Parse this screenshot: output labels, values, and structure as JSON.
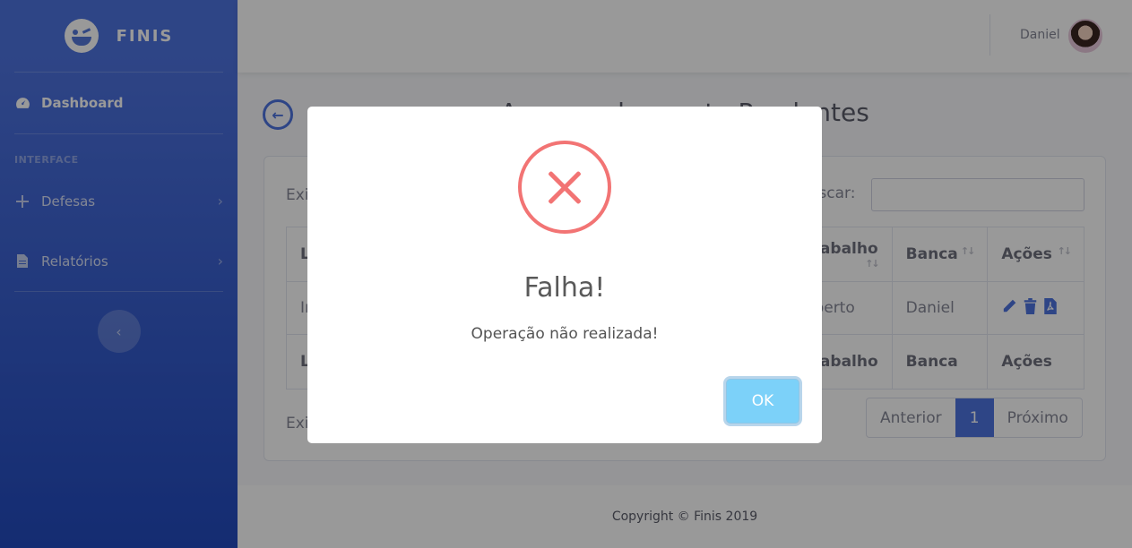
{
  "brand": {
    "name": "FINIS"
  },
  "sidebar": {
    "dashboard": "Dashboard",
    "heading": "INTERFACE",
    "items": [
      {
        "label": "Defesas",
        "icon": "plus-icon"
      },
      {
        "label": "Relatórios",
        "icon": "file-icon"
      }
    ]
  },
  "topbar": {
    "user_name": "Daniel"
  },
  "main": {
    "title": "Acompanhamento Pendentes",
    "length_label": "Exibir",
    "search_label": "Buscar:",
    "table": {
      "headers": [
        "L",
        "Trabalho",
        "Banca",
        "Ações"
      ],
      "rows": [
        [
          "In",
          "Aberto",
          "Daniel",
          ""
        ]
      ],
      "footer": [
        "L",
        "Trabalho",
        "Banca",
        "Ações"
      ]
    },
    "info_label": "Exibindo",
    "pager": {
      "prev": "Anterior",
      "current": "1",
      "next": "Próximo"
    }
  },
  "footer": {
    "copyright": "Copyright © Finis 2019"
  },
  "modal": {
    "title": "Falha!",
    "text": "Operação não realizada!",
    "ok_label": "OK",
    "error_color": "#f27474",
    "ok_color": "#7cd1f9"
  }
}
